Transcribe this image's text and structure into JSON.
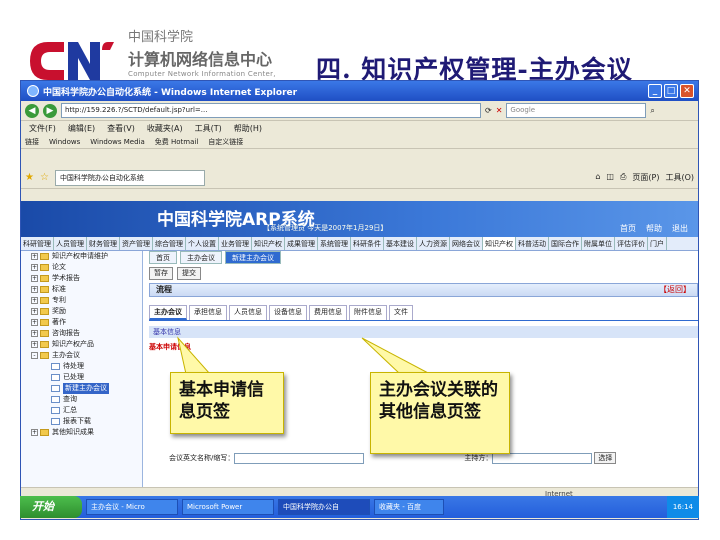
{
  "slide": {
    "org": "中国科学院",
    "center_cn": "计算机网络信息中心",
    "center_en": "Computer Network Information Center,",
    "title": "四. 知识产权管理-主办会议"
  },
  "browser": {
    "title": "中国科学院办公自动化系统 - Windows Internet Explorer",
    "address": "http://159.226.?/SCTD/default.jsp?url=...",
    "search_placeholder": "Google",
    "menu": [
      "文件(F)",
      "编辑(E)",
      "查看(V)",
      "收藏夹(A)",
      "工具(T)",
      "帮助(H)"
    ],
    "links": [
      "链接",
      "Windows",
      "Windows Media",
      "免费 Hotmail",
      "自定义链接"
    ],
    "page_tab": "中国科学院办公自动化系统",
    "tools": [
      "页面(P)",
      "工具(O)"
    ],
    "status": "Internet"
  },
  "app": {
    "title": "中国科学院ARP系统",
    "userinfo": "【系统管理员 今天是2007年1月29日】",
    "toplinks": [
      "首页",
      "帮助",
      "退出"
    ],
    "modules": [
      "科研管理",
      "人员管理",
      "财务管理",
      "资产管理",
      "综合管理",
      "个人设置",
      "业务管理",
      "知识产权",
      "成果管理",
      "系统管理",
      "科研条件",
      "基本建设",
      "人力资源",
      "网络会议",
      "知识产权",
      "科普活动",
      "国际合作",
      "附属单位",
      "评估评价",
      "门户"
    ],
    "active_module_index": 14,
    "tree": [
      {
        "label": "知识产权申请维护",
        "level": 1,
        "expand": "+"
      },
      {
        "label": "论文",
        "level": 1,
        "expand": "+"
      },
      {
        "label": "学术报告",
        "level": 1,
        "expand": "+"
      },
      {
        "label": "标准",
        "level": 1,
        "expand": "+"
      },
      {
        "label": "专利",
        "level": 1,
        "expand": "+"
      },
      {
        "label": "奖励",
        "level": 1,
        "expand": "+"
      },
      {
        "label": "著作",
        "level": 1,
        "expand": "+"
      },
      {
        "label": "咨询报告",
        "level": 1,
        "expand": "+"
      },
      {
        "label": "知识产权产品",
        "level": 1,
        "expand": "+"
      },
      {
        "label": "主办会议",
        "level": 1,
        "expand": "-"
      },
      {
        "label": "待处理",
        "level": 2,
        "expand": ""
      },
      {
        "label": "已处理",
        "level": 2,
        "expand": ""
      },
      {
        "label": "新建主办会议",
        "level": 2,
        "expand": "",
        "selected": true
      },
      {
        "label": "查询",
        "level": 2,
        "expand": ""
      },
      {
        "label": "汇总",
        "level": 2,
        "expand": ""
      },
      {
        "label": "报表下载",
        "level": 2,
        "expand": ""
      },
      {
        "label": "其他知识成果",
        "level": 1,
        "expand": "+"
      }
    ],
    "page_tabs": [
      "首页",
      "主办会议",
      "新建主办会议"
    ],
    "toolbar_buttons": [
      "暂存",
      "提交"
    ],
    "section_title": "流程",
    "section_return": "【返回】",
    "sub_tabs": [
      "主办会议",
      "承担信息",
      "人员信息",
      "设备信息",
      "费用信息",
      "附件信息",
      "文件"
    ],
    "form_head": "基本信息",
    "basic_label": "基本申请信息",
    "field_left_label": "会议英文名称/缩写：",
    "field_right_label": "主持方：",
    "select_btn": "选择"
  },
  "callouts": {
    "left": "基本申请信息页签",
    "right": "主办会议关联的其他信息页签"
  },
  "taskbar": {
    "start": "开始",
    "items": [
      "主办会议 - Micro",
      "Microsoft Power",
      "中国科学院办公自",
      "收藏夹 - 百度"
    ],
    "active_index": 2,
    "clock": "16:14"
  },
  "colors": {
    "title": "#1f1a75",
    "banner": "#1a4aa8",
    "callout": "#fff9a8",
    "accent": "#2f6ad0",
    "logo_red": "#c8102e"
  }
}
